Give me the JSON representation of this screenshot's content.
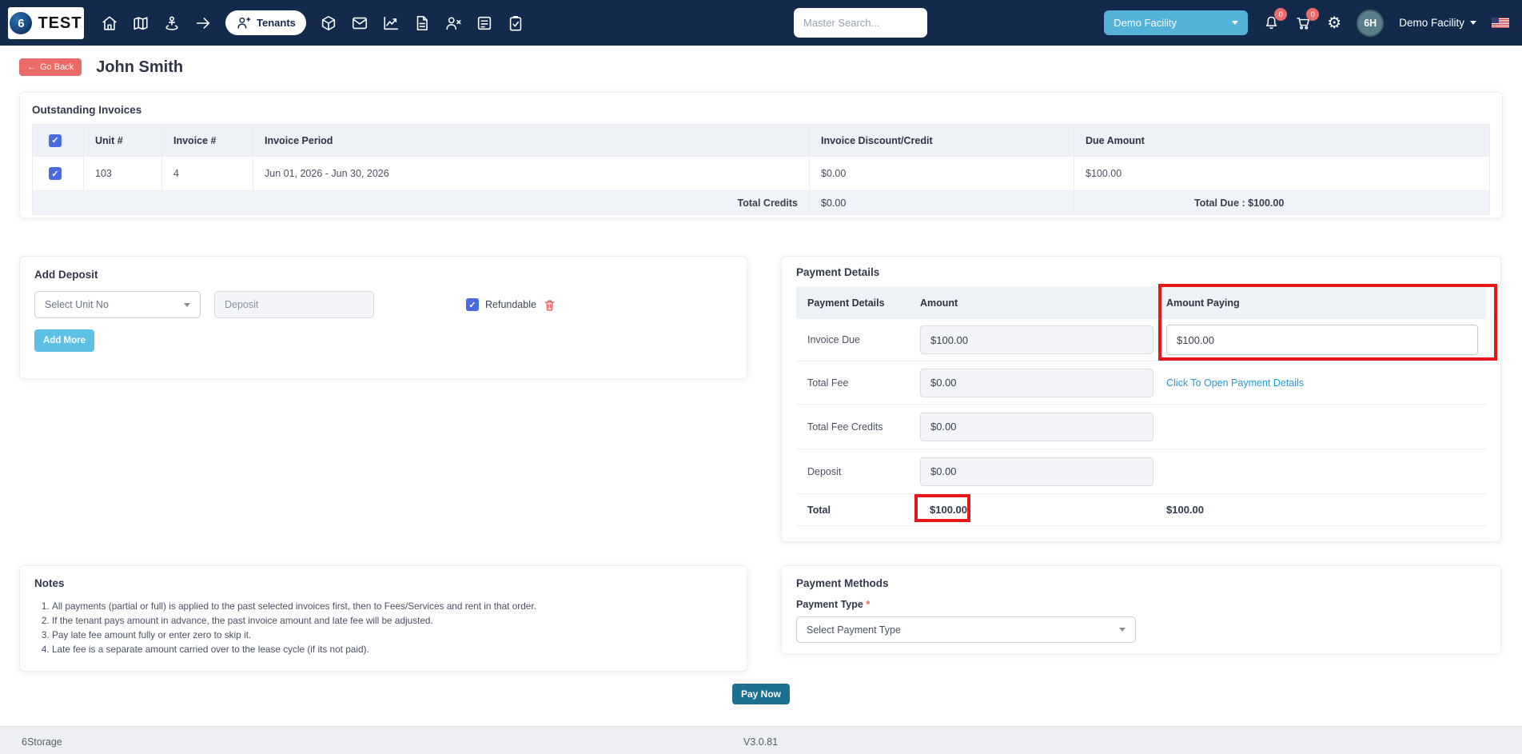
{
  "colors": {
    "navbar_bg": "#142a4d",
    "facility_button": "#55b2d8",
    "badge_red": "#ee6b6b",
    "go_back_red": "#ed6b66",
    "add_more_blue": "#5cc1e5",
    "pay_now_teal": "#1c7090",
    "link_blue": "#229bd5",
    "checkbox_blue": "#4a6be0",
    "annotation_red": "#e51718"
  },
  "navbar": {
    "logo_number": "6",
    "logo_text": "TEST",
    "icons": [
      "home-icon",
      "map-icon",
      "person-stand-icon",
      "arrow-right-icon",
      "tenants-icon",
      "cube-icon",
      "mail-icon",
      "line-chart-icon",
      "document-icon",
      "user-remove-icon",
      "report-icon",
      "clipboard-check-icon",
      "bell-icon",
      "cart-icon",
      "gear-icon",
      "us-flag-icon"
    ],
    "tenants_label": "Tenants",
    "search_placeholder": "Master Search...",
    "facility_selected": "Demo Facility",
    "notifications_badge": "0",
    "cart_badge": "0",
    "avatar_initials": "6H",
    "user_label": "Demo Facility"
  },
  "page_header": {
    "go_back_label": "Go Back",
    "title": "John Smith"
  },
  "outstanding_invoices": {
    "title": "Outstanding Invoices",
    "columns": [
      "",
      "Unit #",
      "Invoice #",
      "Invoice Period",
      "Invoice Discount/Credit",
      "Due Amount"
    ],
    "header_checkbox_checked": true,
    "rows": [
      {
        "checked": true,
        "unit": "103",
        "invoice_no": "4",
        "period": "Jun 01, 2026 - Jun 30, 2026",
        "discount_credit": "$0.00",
        "due_amount": "$100.00"
      }
    ],
    "totals": {
      "credits_label": "Total Credits",
      "credits_value": "$0.00",
      "total_due": "Total Due : $100.00"
    }
  },
  "add_deposit": {
    "title": "Add Deposit",
    "unit_placeholder": "Select Unit No",
    "deposit_placeholder": "Deposit",
    "refundable_label": "Refundable",
    "refundable_checked": true,
    "add_more_label": "Add More"
  },
  "payment_details": {
    "title": "Payment Details",
    "columns": [
      "Payment Details",
      "Amount",
      "Amount Paying"
    ],
    "rows": [
      {
        "label": "Invoice Due",
        "amount": "$100.00",
        "paying": "$100.00"
      },
      {
        "label": "Total Fee",
        "amount": "$0.00",
        "link": "Click To Open Payment Details"
      },
      {
        "label": "Total Fee Credits",
        "amount": "$0.00"
      },
      {
        "label": "Deposit",
        "amount": "$0.00"
      },
      {
        "label": "Total",
        "amount": "$100.00",
        "paying": "$100.00"
      }
    ]
  },
  "notes": {
    "title": "Notes",
    "items": [
      "All payments (partial or full) is applied to the past selected invoices first, then to Fees/Services and rent in that order.",
      "If the tenant pays amount in advance, the past invoice amount and late fee will be adjusted.",
      "Pay late fee amount fully or enter zero to skip it.",
      "Late fee is a separate amount carried over to the lease cycle (if its not paid)."
    ]
  },
  "payment_methods": {
    "title": "Payment Methods",
    "type_label": "Payment Type",
    "required_mark": "*",
    "select_placeholder": "Select Payment Type"
  },
  "actions": {
    "pay_now_label": "Pay Now"
  },
  "footer": {
    "brand": "6Storage",
    "version": "V3.0.81"
  }
}
